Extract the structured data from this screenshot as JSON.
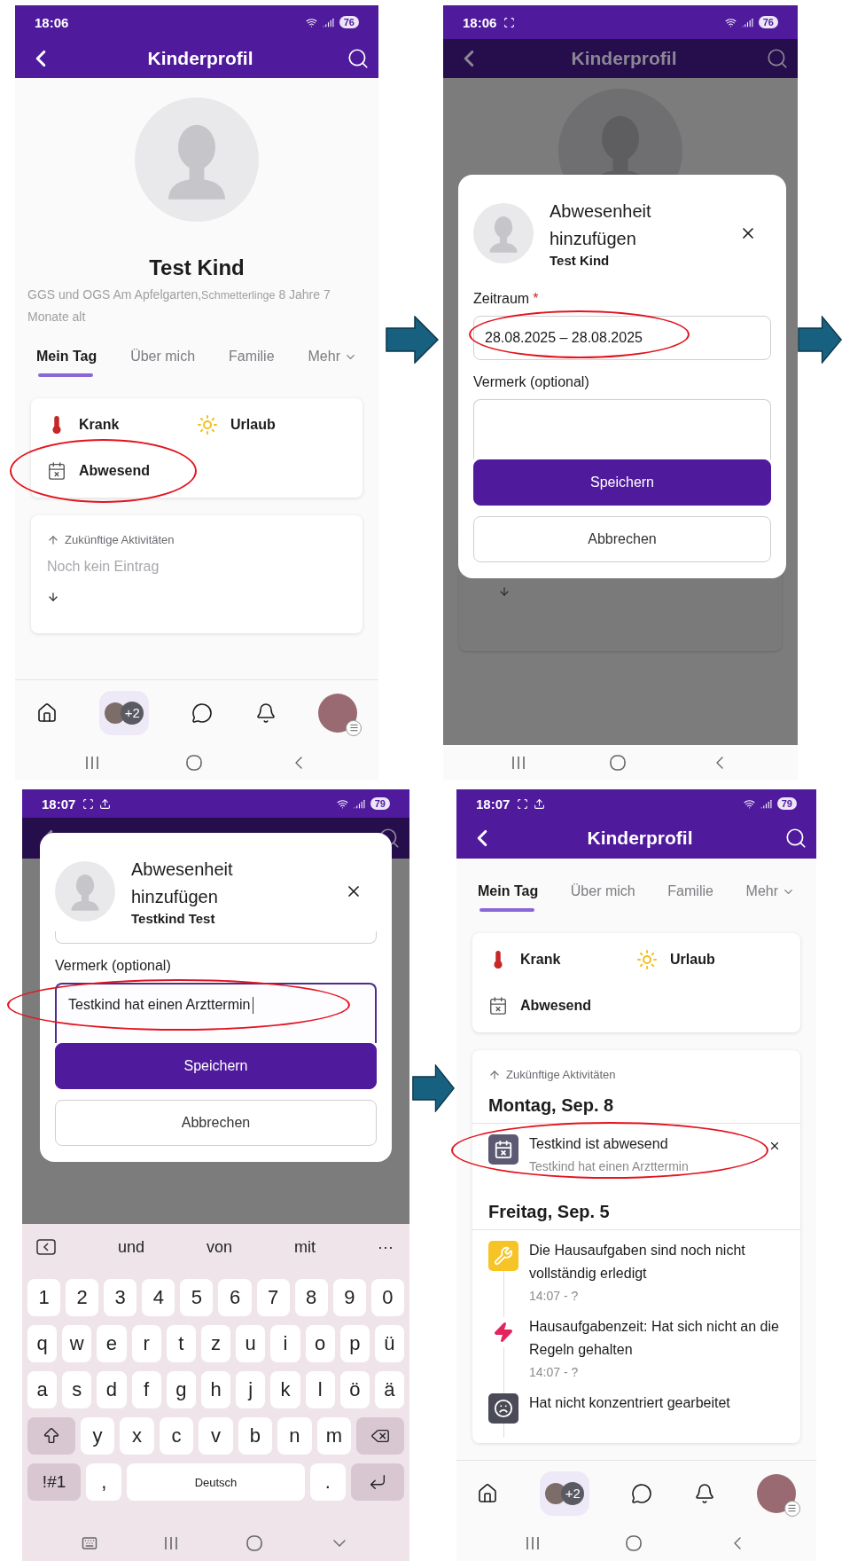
{
  "screens": [
    {
      "kind": "profile",
      "status_bar": {
        "time": "18:06",
        "battery": "76",
        "screenshot": false,
        "upload": false
      },
      "header": {
        "title": "Kinderprofil",
        "dimmed": false
      },
      "profile": {
        "name": "Test Kind",
        "school": "GGS und OGS Am Apfelgarten,",
        "group": "Schmetterlinge",
        "age": "8 Jahre 7 Monate alt"
      },
      "tabs": [
        {
          "label": "Mein Tag",
          "selected": true,
          "dropdown": false
        },
        {
          "label": "Über mich",
          "selected": false,
          "dropdown": false
        },
        {
          "label": "Familie",
          "selected": false,
          "dropdown": false
        },
        {
          "label": "Mehr",
          "selected": false,
          "dropdown": true
        }
      ],
      "status_options": [
        {
          "kind": "sick",
          "label": "Krank",
          "highlighted": false
        },
        {
          "kind": "vacation",
          "label": "Urlaub",
          "highlighted": false
        },
        {
          "kind": "absent",
          "label": "Abwesend",
          "highlighted": true
        }
      ],
      "activities": {
        "heading": "Zukünftige Aktivitäten",
        "empty_text": "Noch kein Eintrag"
      },
      "bottom_nav": {
        "group_badge": "+2"
      },
      "system_nav": {
        "keyboard_open": false
      }
    },
    {
      "kind": "dialog",
      "status_bar": {
        "time": "18:06",
        "battery": "76",
        "screenshot": true,
        "upload": false
      },
      "header": {
        "title": "Kinderprofil",
        "dimmed": true
      },
      "dialog": {
        "title": "Abwesenheit hinzufügen",
        "subtitle": "Test Kind",
        "fields": [
          {
            "kind": "date_range",
            "label": "Zeitraum",
            "required_mark": "*",
            "value": "28.08.2025 – 28.08.2025",
            "highlighted": true
          },
          {
            "kind": "note",
            "label": "Vermerk (optional)",
            "focused": false,
            "highlighted": false
          }
        ],
        "buttons": [
          {
            "kind": "primary",
            "label": "Speichern"
          },
          {
            "kind": "secondary",
            "label": "Abbrechen"
          }
        ]
      },
      "system_nav": {
        "keyboard_open": false
      }
    },
    {
      "kind": "dialog_keyboard",
      "status_bar": {
        "time": "18:07",
        "battery": "79",
        "screenshot": true,
        "upload": true
      },
      "header": {
        "dimmed": true
      },
      "dialog": {
        "title": "Abwesenheit hinzufügen",
        "subtitle": "Testkind Test",
        "fields": [
          {
            "kind": "partial"
          },
          {
            "kind": "note",
            "label": "Vermerk (optional)",
            "value": "Testkind hat einen Arzttermin",
            "focused": true,
            "highlighted": true
          }
        ],
        "buttons": [
          {
            "kind": "primary",
            "label": "Speichern"
          },
          {
            "kind": "secondary",
            "label": "Abbrechen"
          }
        ]
      },
      "keyboard": {
        "suggestions": [
          "und",
          "von",
          "mit"
        ],
        "more": "···",
        "rows": [
          {
            "keys": [
              {
                "kind": "char",
                "label": "1"
              },
              {
                "kind": "char",
                "label": "2"
              },
              {
                "kind": "char",
                "label": "3"
              },
              {
                "kind": "char",
                "label": "4"
              },
              {
                "kind": "char",
                "label": "5"
              },
              {
                "kind": "char",
                "label": "6"
              },
              {
                "kind": "char",
                "label": "7"
              },
              {
                "kind": "char",
                "label": "8"
              },
              {
                "kind": "char",
                "label": "9"
              },
              {
                "kind": "char",
                "label": "0"
              }
            ]
          },
          {
            "keys": [
              {
                "kind": "char",
                "label": "q"
              },
              {
                "kind": "char",
                "label": "w"
              },
              {
                "kind": "char",
                "label": "e"
              },
              {
                "kind": "char",
                "label": "r"
              },
              {
                "kind": "char",
                "label": "t"
              },
              {
                "kind": "char",
                "label": "z"
              },
              {
                "kind": "char",
                "label": "u"
              },
              {
                "kind": "char",
                "label": "i"
              },
              {
                "kind": "char",
                "label": "o"
              },
              {
                "kind": "char",
                "label": "p"
              },
              {
                "kind": "char",
                "label": "ü"
              }
            ]
          },
          {
            "keys": [
              {
                "kind": "char",
                "label": "a"
              },
              {
                "kind": "char",
                "label": "s"
              },
              {
                "kind": "char",
                "label": "d"
              },
              {
                "kind": "char",
                "label": "f"
              },
              {
                "kind": "char",
                "label": "g"
              },
              {
                "kind": "char",
                "label": "h"
              },
              {
                "kind": "char",
                "label": "j"
              },
              {
                "kind": "char",
                "label": "k"
              },
              {
                "kind": "char",
                "label": "l"
              },
              {
                "kind": "char",
                "label": "ö"
              },
              {
                "kind": "char",
                "label": "ä"
              }
            ]
          },
          {
            "keys": [
              {
                "kind": "shift"
              },
              {
                "kind": "char",
                "label": "y"
              },
              {
                "kind": "char",
                "label": "x"
              },
              {
                "kind": "char",
                "label": "c"
              },
              {
                "kind": "char",
                "label": "v"
              },
              {
                "kind": "char",
                "label": "b"
              },
              {
                "kind": "char",
                "label": "n"
              },
              {
                "kind": "char",
                "label": "m"
              },
              {
                "kind": "backspace"
              }
            ]
          },
          {
            "keys": [
              {
                "kind": "symbols",
                "label": "!#1"
              },
              {
                "kind": "char",
                "label": ","
              },
              {
                "kind": "space",
                "label": "Deutsch"
              },
              {
                "kind": "char",
                "label": "."
              },
              {
                "kind": "enter"
              }
            ]
          }
        ]
      },
      "system_nav": {
        "keyboard_open": true
      }
    },
    {
      "kind": "profile",
      "status_bar": {
        "time": "18:07",
        "battery": "79",
        "screenshot": true,
        "upload": true
      },
      "header": {
        "title": "Kinderprofil",
        "dimmed": false
      },
      "tabs": [
        {
          "label": "Mein Tag",
          "selected": true,
          "dropdown": false
        },
        {
          "label": "Über mich",
          "selected": false,
          "dropdown": false
        },
        {
          "label": "Familie",
          "selected": false,
          "dropdown": false
        },
        {
          "label": "Mehr",
          "selected": false,
          "dropdown": true
        }
      ],
      "status_options": [
        {
          "kind": "sick",
          "label": "Krank",
          "highlighted": false
        },
        {
          "kind": "vacation",
          "label": "Urlaub",
          "highlighted": false
        },
        {
          "kind": "absent",
          "label": "Abwesend",
          "highlighted": false
        }
      ],
      "activities": {
        "heading": "Zukünftige Aktivitäten",
        "days": [
          {
            "date": "Montag, Sep. 8",
            "entries": [
              {
                "kind": "absent",
                "title": "Testkind ist abwesend",
                "note": "Testkind hat einen Arzttermin",
                "removable": true,
                "highlighted": true
              }
            ]
          },
          {
            "date": "Freitag, Sep. 5",
            "entries": [
              {
                "kind": "homework",
                "title": "Die Hausaufgaben sind noch nicht vollständig erledigt",
                "time": "14:07 - ?",
                "removable": false,
                "highlighted": false
              },
              {
                "kind": "rule",
                "title": "Hausaufgabenzeit: Hat sich nicht an die Regeln gehalten",
                "time": "14:07 - ?",
                "removable": false,
                "highlighted": false
              },
              {
                "kind": "unfocused",
                "title": "Hat nicht konzentriert gearbeitet",
                "removable": false,
                "highlighted": false
              }
            ]
          }
        ]
      },
      "bottom_nav": {
        "group_badge": "+2"
      },
      "system_nav": {
        "keyboard_open": false
      }
    }
  ]
}
